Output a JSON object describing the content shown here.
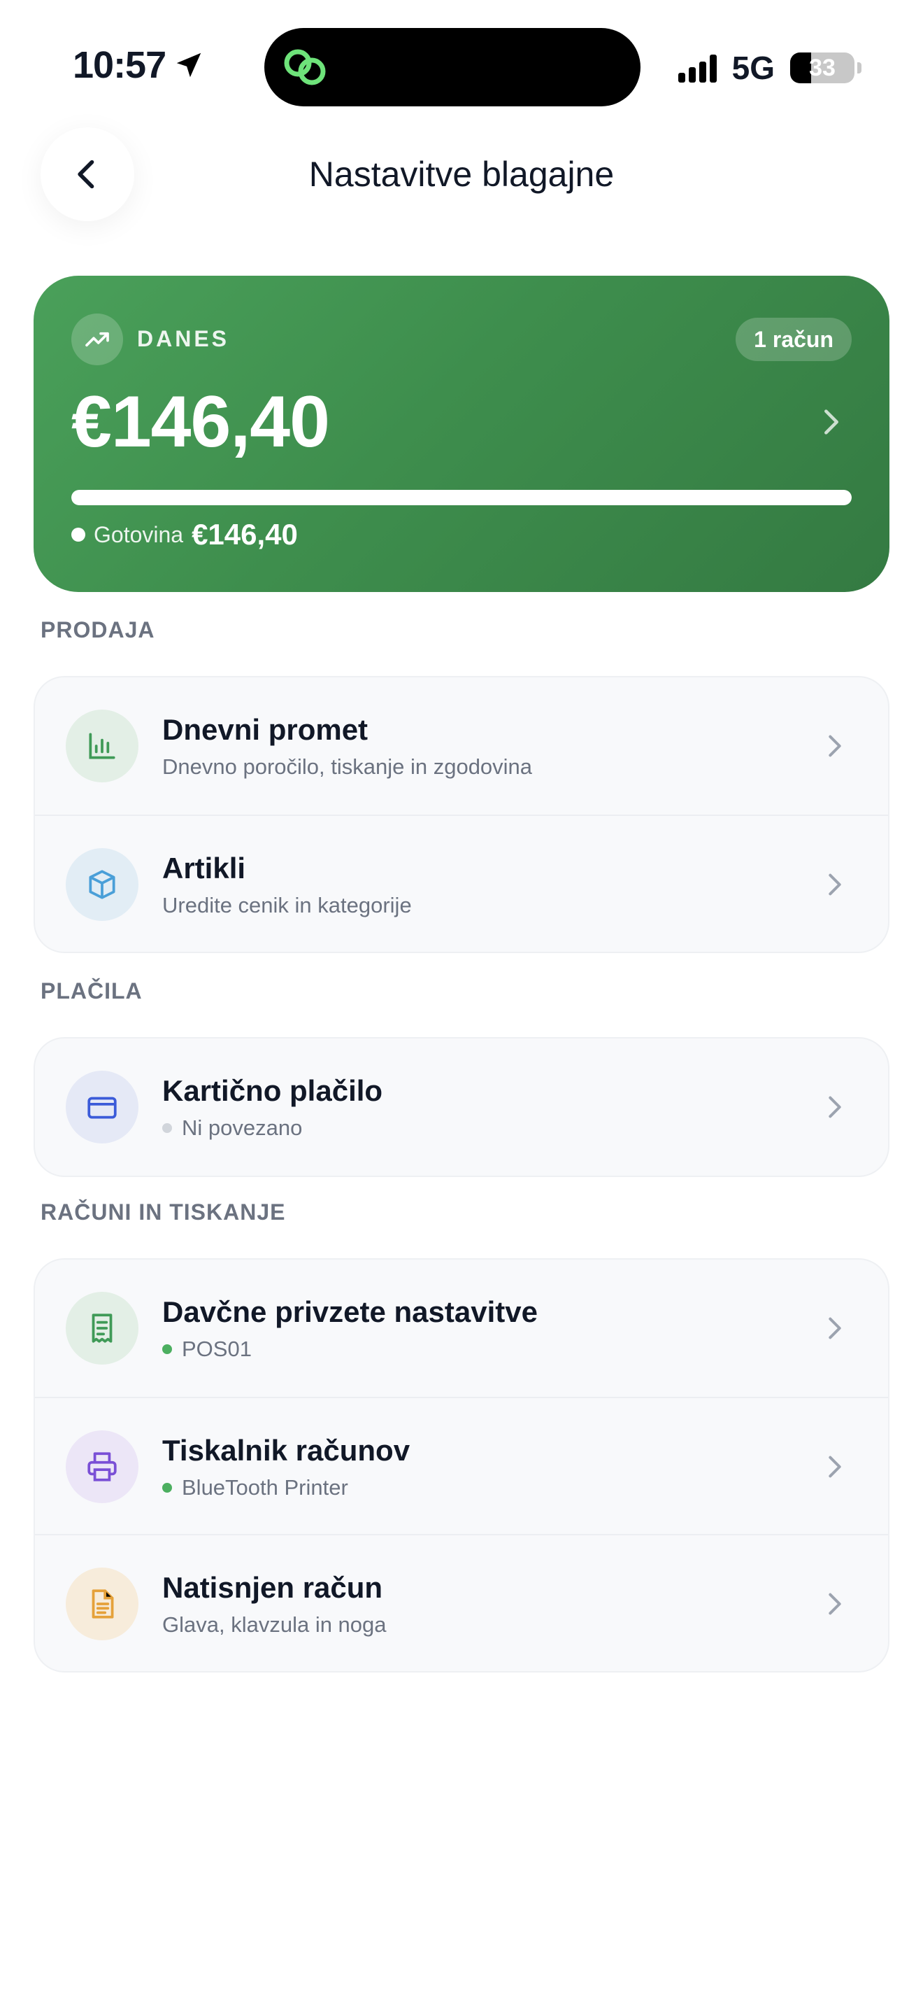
{
  "status_bar": {
    "time": "10:57",
    "network": "5G",
    "battery": "33"
  },
  "header": {
    "title": "Nastavitve blagajne"
  },
  "today": {
    "label": "DANES",
    "receipts_badge": "1 račun",
    "amount": "€146,40",
    "cash_share": 1.0,
    "legend_label": "Gotovina",
    "legend_value": "€146,40"
  },
  "sections": {
    "sales": {
      "title": "PRODAJA",
      "items": [
        {
          "title": "Dnevni promet",
          "subtitle": "Dnevno poročilo, tiskanje in zgodovina",
          "icon": "bar-chart-icon"
        },
        {
          "title": "Artikli",
          "subtitle": "Uredite cenik in kategorije",
          "icon": "box-icon"
        }
      ]
    },
    "payments": {
      "title": "PLAČILA",
      "items": [
        {
          "title": "Kartično plačilo",
          "subtitle": "Ni povezano",
          "status_color": "#d1d5db",
          "icon": "credit-card-icon"
        }
      ]
    },
    "receipts": {
      "title": "RAČUNI IN TISKANJE",
      "items": [
        {
          "title": "Davčne privzete nastavitve",
          "subtitle": "POS01",
          "status_color": "#4caf60",
          "icon": "receipt-icon"
        },
        {
          "title": "Tiskalnik računov",
          "subtitle": "BlueTooth Printer",
          "status_color": "#4caf60",
          "icon": "printer-icon"
        },
        {
          "title": "Natisnjen račun",
          "subtitle": "Glava, klavzula in noga",
          "icon": "document-icon"
        }
      ]
    }
  },
  "colors": {
    "card_green": "#3e8e4d",
    "icon_green": "#3f9a57",
    "icon_blue": "#4a9fd8",
    "icon_card_blue": "#3b5bd9",
    "icon_purple": "#7a4fd6",
    "icon_orange": "#e5a13a"
  }
}
